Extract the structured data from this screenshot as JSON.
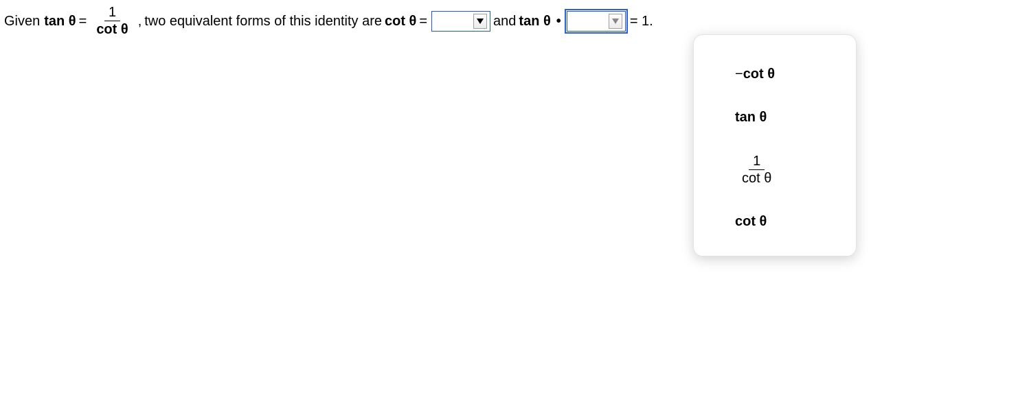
{
  "question": {
    "lead": "Given",
    "tan_theta_bold": "tan θ",
    "equals": "=",
    "frac_num": "1",
    "frac_den_bold": "cot θ",
    "comma": ",",
    "mid": " two equivalent forms of this identity are ",
    "cot_theta_bold": "cot θ",
    "and": " and ",
    "dot": "•",
    "equals_one": "= 1."
  },
  "dropdown1": {
    "value": "",
    "selected": false
  },
  "dropdown2": {
    "value": "",
    "selected": true,
    "options": {
      "neg_cot_prefix": "− ",
      "neg_cot": "cot θ",
      "tan": "tan θ",
      "inv_cot_num": "1",
      "inv_cot_den": "cot θ",
      "cot": "cot θ"
    }
  }
}
